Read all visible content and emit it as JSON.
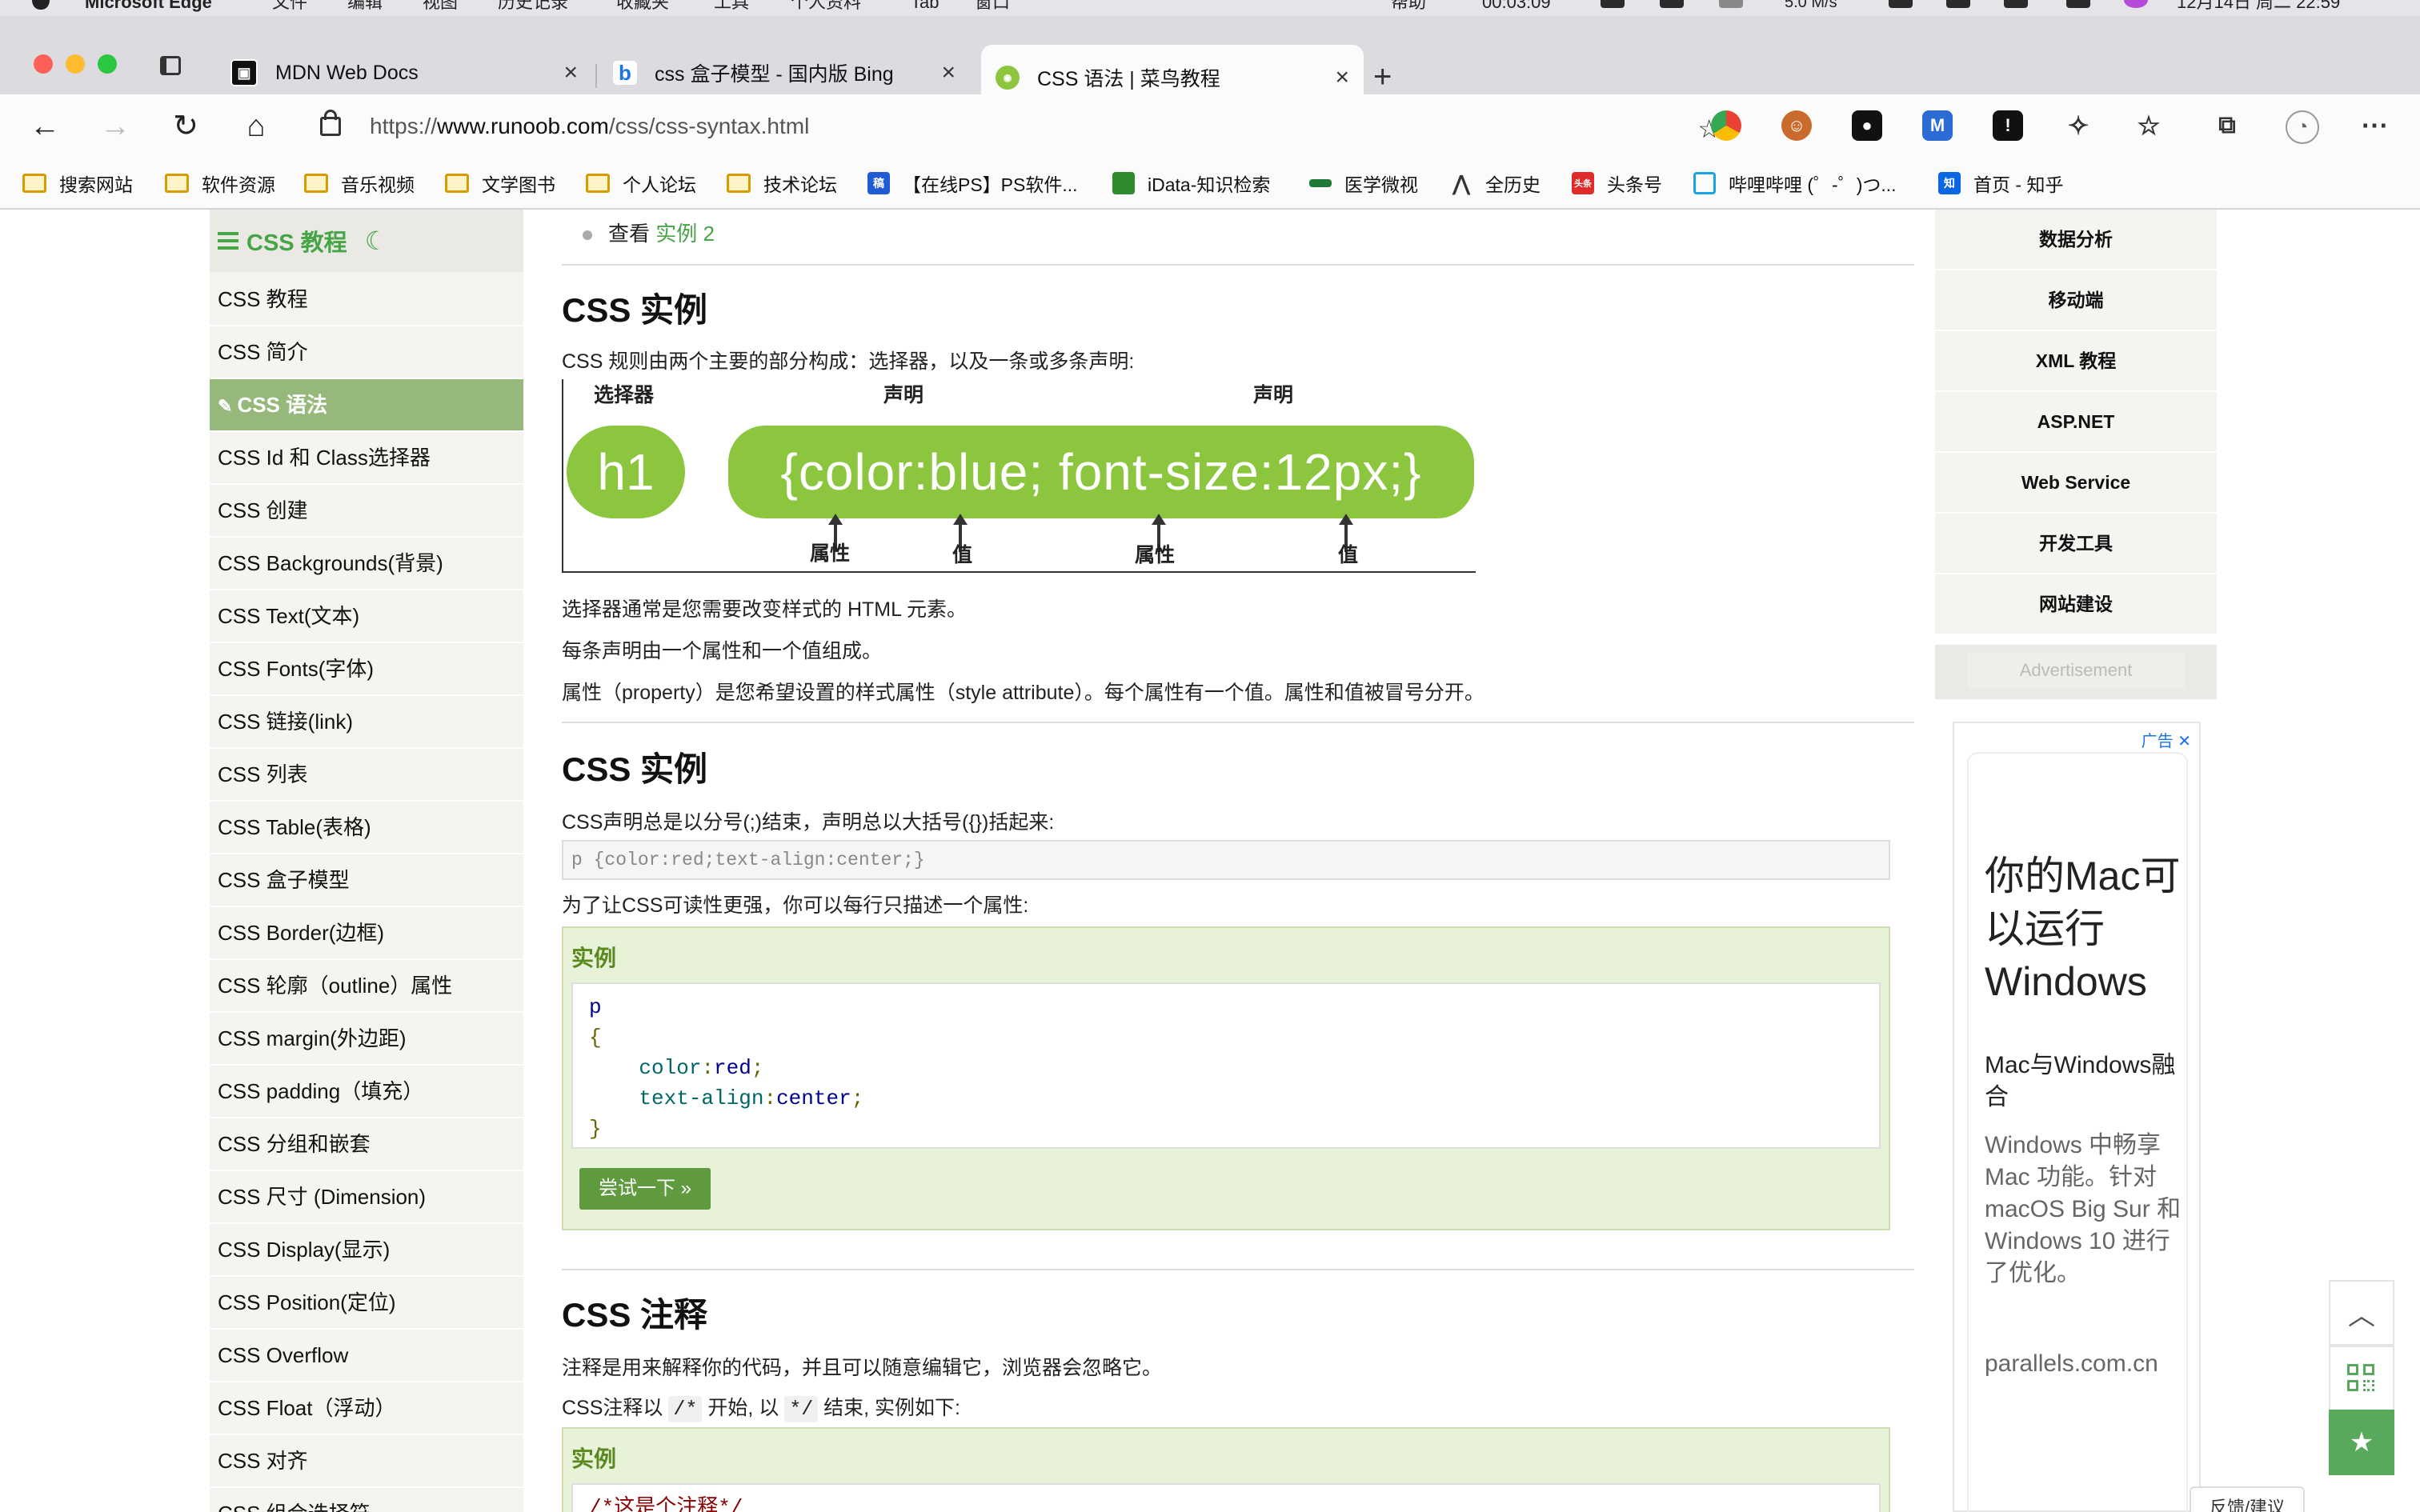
{
  "menubar": {
    "app_name": "Microsoft Edge",
    "menus": [
      "文件",
      "编辑",
      "视图",
      "历史记录",
      "收藏夹",
      "工具",
      "个人资料",
      "Tab",
      "窗口",
      "帮助"
    ],
    "timer": "00:03:09",
    "network_speed": "5.0 M/s",
    "datetime": "12月14日 周二 22:59"
  },
  "tabs": [
    {
      "title": "MDN Web Docs",
      "active": false
    },
    {
      "title": "css 盒子模型 - 国内版 Bing",
      "active": false
    },
    {
      "title": "CSS 语法 | 菜鸟教程",
      "active": true
    }
  ],
  "toolbar": {
    "url_prefix": "https://",
    "url_domain": "www.runoob.com",
    "url_path": "/css/css-syntax.html"
  },
  "bookmarks": [
    {
      "label": "搜索网站",
      "type": "folder"
    },
    {
      "label": "软件资源",
      "type": "folder"
    },
    {
      "label": "音乐视频",
      "type": "folder"
    },
    {
      "label": "文学图书",
      "type": "folder"
    },
    {
      "label": "个人论坛",
      "type": "folder"
    },
    {
      "label": "技术论坛",
      "type": "folder"
    },
    {
      "label": "【在线PS】PS软件...",
      "type": "link",
      "icon": "稿"
    },
    {
      "label": "iData-知识检索",
      "type": "link",
      "icon": ""
    },
    {
      "label": "医学微视",
      "type": "link",
      "icon": ""
    },
    {
      "label": "全历史",
      "type": "link",
      "icon": ""
    },
    {
      "label": "头条号",
      "type": "link",
      "icon": "头条"
    },
    {
      "label": "哔哩哔哩 (゜-゜)つ...",
      "type": "link",
      "icon": ""
    },
    {
      "label": "首页 - 知乎",
      "type": "link",
      "icon": "知"
    }
  ],
  "sidebar": {
    "title": "CSS 教程",
    "items": [
      {
        "label": "CSS 教程",
        "active": false
      },
      {
        "label": "CSS 简介",
        "active": false
      },
      {
        "label": "CSS 语法",
        "active": true
      },
      {
        "label": "CSS Id 和 Class选择器",
        "active": false
      },
      {
        "label": "CSS 创建",
        "active": false
      },
      {
        "label": "CSS Backgrounds(背景)",
        "active": false
      },
      {
        "label": "CSS Text(文本)",
        "active": false
      },
      {
        "label": "CSS Fonts(字体)",
        "active": false
      },
      {
        "label": "CSS 链接(link)",
        "active": false
      },
      {
        "label": "CSS 列表",
        "active": false
      },
      {
        "label": "CSS Table(表格)",
        "active": false
      },
      {
        "label": "CSS 盒子模型",
        "active": false
      },
      {
        "label": "CSS Border(边框)",
        "active": false
      },
      {
        "label": "CSS 轮廓（outline）属性",
        "active": false
      },
      {
        "label": "CSS margin(外边距)",
        "active": false
      },
      {
        "label": "CSS padding（填充）",
        "active": false
      },
      {
        "label": "CSS 分组和嵌套",
        "active": false
      },
      {
        "label": "CSS 尺寸 (Dimension)",
        "active": false
      },
      {
        "label": "CSS Display(显示)",
        "active": false
      },
      {
        "label": "CSS Position(定位)",
        "active": false
      },
      {
        "label": "CSS Overflow",
        "active": false
      },
      {
        "label": "CSS Float（浮动）",
        "active": false
      },
      {
        "label": "CSS 对齐",
        "active": false
      },
      {
        "label": "CSS 组合选择符",
        "active": false
      }
    ]
  },
  "content": {
    "see_prefix": "查看",
    "see_link": "实例 2",
    "section1": {
      "heading": "CSS 实例",
      "intro": "CSS 规则由两个主要的部分构成：选择器，以及一条或多条声明:",
      "diagram": {
        "label_selector": "选择器",
        "label_decl_1": "声明",
        "label_decl_2": "声明",
        "selector": "h1",
        "declaration": "{color:blue; font-size:12px;}",
        "label_prop_1": "属性",
        "label_val_1": "值",
        "label_prop_2": "属性",
        "label_val_2": "值"
      },
      "para1": "选择器通常是您需要改变样式的 HTML 元素。",
      "para2": "每条声明由一个属性和一个值组成。",
      "para3": "属性（property）是您希望设置的样式属性（style attribute）。每个属性有一个值。属性和值被冒号分开。"
    },
    "section2": {
      "heading": "CSS 实例",
      "intro": "CSS声明总是以分号(;)结束，声明总以大括号({})括起来:",
      "code_inline": "p {color:red;text-align:center;}",
      "para": "为了让CSS可读性更强，你可以每行只描述一个属性:",
      "example_title": "实例",
      "code_lines": {
        "l1": "p",
        "l2": "{",
        "l3_prop": "color",
        "l3_val": "red",
        "l4_prop": "text-align",
        "l4_val": "center",
        "l5": "}"
      },
      "try_button": "尝试一下 »"
    },
    "section3": {
      "heading": "CSS 注释",
      "intro": "注释是用来解释你的代码，并且可以随意编辑它，浏览器会忽略它。",
      "para_prefix": "CSS注释以",
      "code_open": "/*",
      "para_mid": "开始, 以",
      "code_close": "*/",
      "para_suffix": "结束, 实例如下:",
      "example_title": "实例",
      "code_first": "/*这是个注释*/"
    }
  },
  "rightbar": {
    "items": [
      "数据分析",
      "移动端",
      "XML 教程",
      "ASP.NET",
      "Web Service",
      "开发工具",
      "网站建设"
    ],
    "advertisement": "Advertisement"
  },
  "ad": {
    "tag": "广告",
    "headline": "你的Mac可以运行Windows",
    "subhead": "Mac与Windows融合",
    "body": "Windows 中畅享 Mac 功能。针对 macOS Big Sur 和Windows 10 进行了优化。",
    "domain": "parallels.com.cn"
  },
  "feedback": "反馈/建议"
}
